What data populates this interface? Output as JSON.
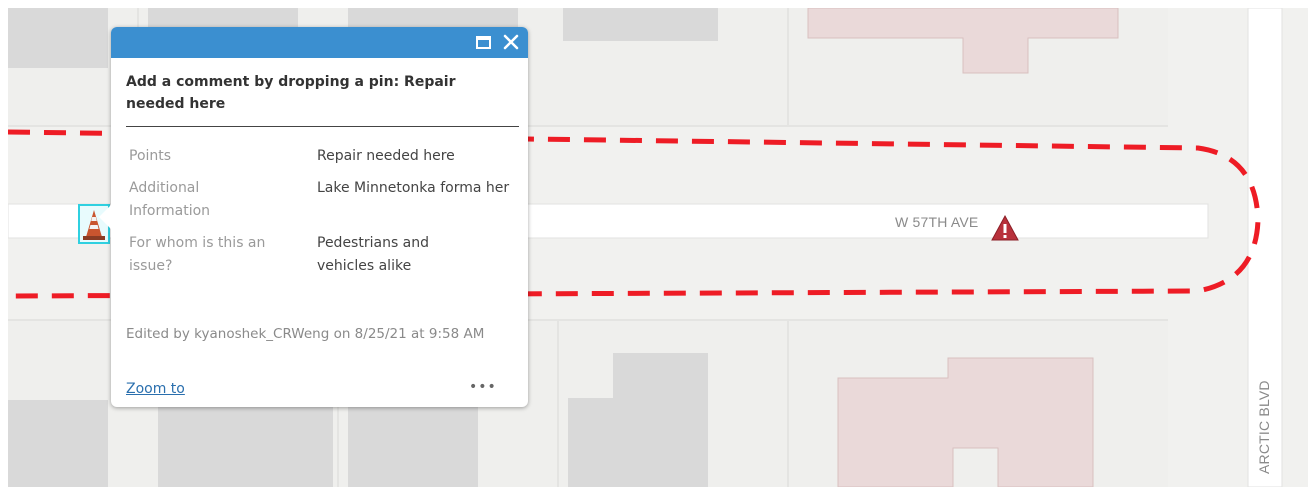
{
  "map": {
    "road_labels": {
      "w57th": "W 57TH AVE",
      "arctic": "ARCTIC BLVD"
    },
    "colors": {
      "background": "#f1f1ef",
      "building_gray": "#d9d9d9",
      "building_pink": "#ead9d9",
      "route": "#ee1c25"
    },
    "markers": {
      "selected": "traffic-cone-icon",
      "other": "warning-triangle-icon"
    }
  },
  "popup": {
    "header_color": "#3b8fd0",
    "title": "Add a comment by dropping a pin: Repair needed here",
    "fields": [
      {
        "name": "Points",
        "value": "Repair needed here"
      },
      {
        "name": "Additional Information",
        "value": "Lake Minnetonka forma her"
      },
      {
        "name": "For whom is this an issue?",
        "value": "Pedestrians and vehicles alike"
      }
    ],
    "edited": "Edited by kyanoshek_CRWeng on 8/25/21 at 9:58 AM",
    "zoom_label": "Zoom to",
    "more_label": "•••"
  }
}
